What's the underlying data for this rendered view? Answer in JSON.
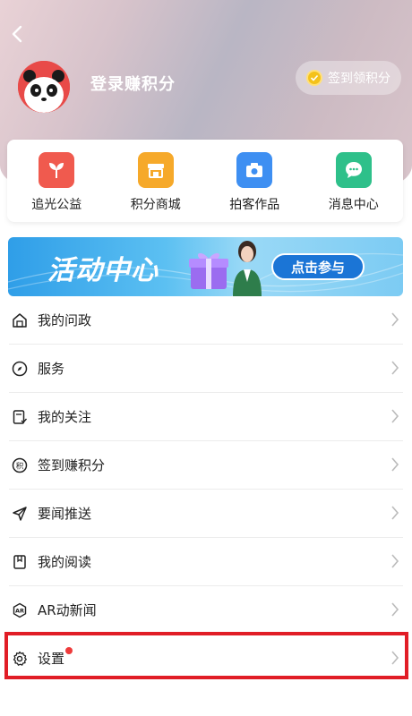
{
  "header": {
    "login_text": "登录赚积分",
    "checkin_label": "签到领积分"
  },
  "quick_links": [
    {
      "label": "追光公益",
      "color": "#f05a4e",
      "icon": "sprout-icon"
    },
    {
      "label": "积分商城",
      "color": "#f6a92a",
      "icon": "shop-icon"
    },
    {
      "label": "拍客作品",
      "color": "#3e8ff2",
      "icon": "camera-icon"
    },
    {
      "label": "消息中心",
      "color": "#2ec08a",
      "icon": "chat-icon"
    }
  ],
  "banner": {
    "title": "活动中心",
    "button": "点击参与"
  },
  "menu": [
    {
      "label": "我的问政",
      "icon": "house-icon"
    },
    {
      "label": "服务",
      "icon": "compass-icon"
    },
    {
      "label": "我的关注",
      "icon": "follow-icon"
    },
    {
      "label": "签到赚积分",
      "icon": "points-icon"
    },
    {
      "label": "要闻推送",
      "icon": "send-icon"
    },
    {
      "label": "我的阅读",
      "icon": "book-icon"
    },
    {
      "label": "AR动新闻",
      "icon": "ar-icon"
    },
    {
      "label": "设置",
      "icon": "gear-icon"
    }
  ]
}
